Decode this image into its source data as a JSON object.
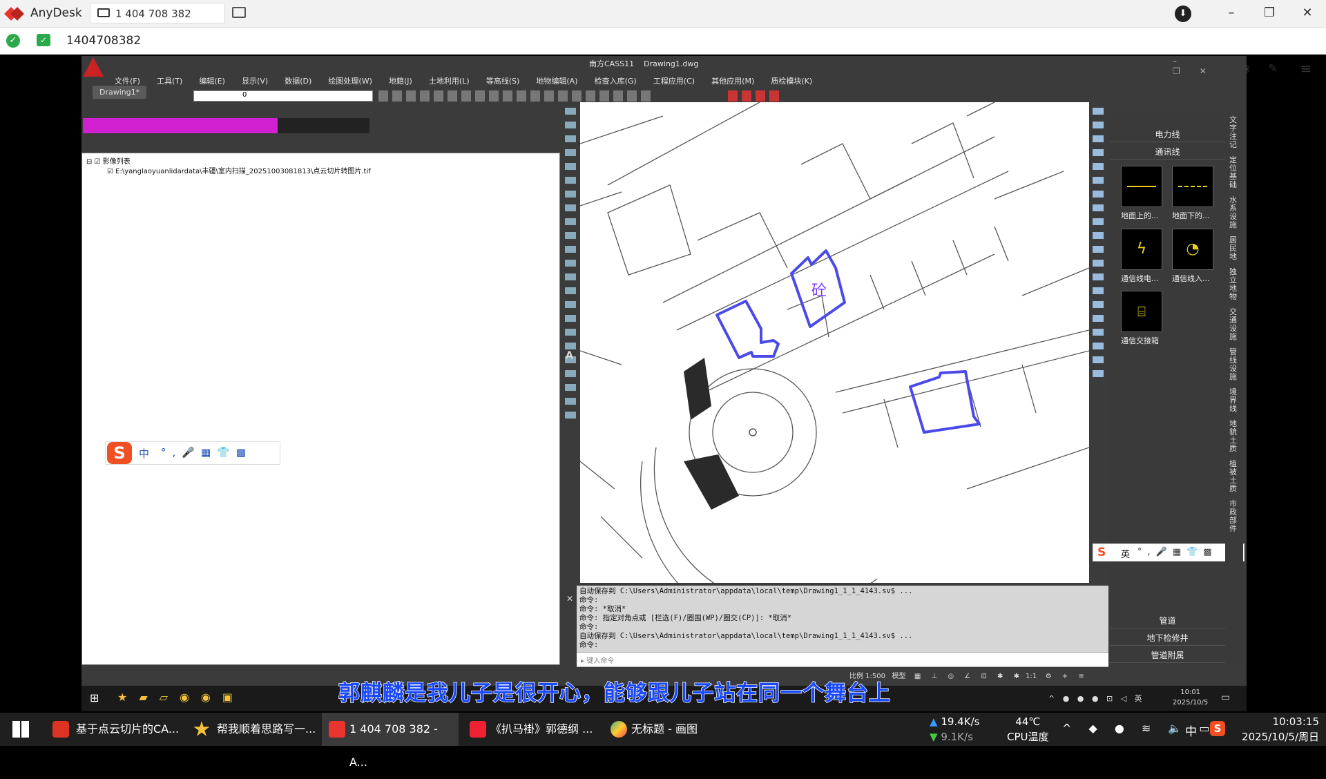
{
  "anydesk": {
    "app_name": "AnyDesk",
    "tab_label": "1 404 708 382",
    "address_value": "1404708382"
  },
  "cad": {
    "title": "南方CASS11",
    "drawing_name": "Drawing1.dwg",
    "menu": [
      "文件(F)",
      "工具(T)",
      "编辑(E)",
      "显示(V)",
      "数据(D)",
      "绘图处理(W)",
      "地籍(J)",
      "土地利用(L)",
      "等高线(S)",
      "地物编辑(A)",
      "检查入库(G)",
      "工程应用(C)",
      "其他应用(M)",
      "质检模块(K)"
    ],
    "doc_tab": "Drawing1*",
    "layer_value": "0",
    "tree_root": "影像列表",
    "tree_child": "E:\\yanglaoyuanlidardata\\丰疆\\室内扫描_20251003081813\\点云切片转图片.tif",
    "canvas_label": "砼",
    "command_lines": [
      "自动保存到 C:\\Users\\Administrator\\appdata\\local\\temp\\Drawing1_1_1_4143.sv$ ...",
      "命令:",
      "命令: *取消*",
      "命令: 指定对角点或 [栏选(F)/圈围(WP)/圈交(CP)]: *取消*",
      "命令:",
      "自动保存到 C:\\Users\\Administrator\\appdata\\local\\temp\\Drawing1_1_1_4143.sv$ ...",
      "命令:"
    ],
    "command_placeholder": "键入命令",
    "scale": "比例 1:500",
    "model": "模型",
    "status_scale2": "1:1"
  },
  "right_panel": {
    "cat1": "电力线",
    "cat2": "通讯线",
    "symbols": [
      "地面上的...",
      "地面下的...",
      "通信线电...",
      "通信线入...",
      "通信交接箱"
    ],
    "bottom": [
      "管道",
      "地下检修井",
      "管道附属"
    ],
    "vtabs": [
      "文字注记",
      "定位基础",
      "水系设施",
      "居民地",
      "独立地物",
      "交通设施",
      "管线设施",
      "境界线",
      "地貌土质",
      "植被土质",
      "市政部件"
    ]
  },
  "inner_taskbar": {
    "time": "10:01",
    "date": "2025/10/5",
    "lang": "英"
  },
  "subtitle": "郭麒麟是我儿子是很开心，能够跟儿子站在同一个舞台上",
  "ime": {
    "mode_left": "中",
    "mode_right": "英"
  },
  "taskbar": {
    "apps": [
      "基于点云切片的CA...",
      "帮我顺着思路写一...",
      "1 404 708 382 - A...",
      "《扒马褂》郭德纲 ...",
      "无标题 - 画图"
    ],
    "net_up": "19.4K/s",
    "net_down": "9.1K/s",
    "temp": "44℃",
    "temp_label": "CPU温度",
    "lang": "中",
    "time": "10:03:15",
    "date": "2025/10/5/周日"
  }
}
